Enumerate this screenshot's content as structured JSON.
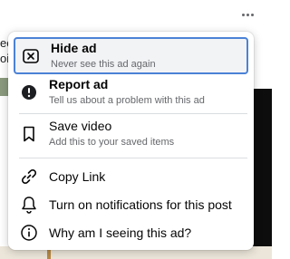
{
  "background": {
    "snippet_line1": "ec",
    "snippet_line2": "oil"
  },
  "menu": {
    "items": [
      {
        "title": "Hide ad",
        "subtitle": "Never see this ad again",
        "icon": "close-box-icon",
        "selected": true
      },
      {
        "title": "Report ad",
        "subtitle": "Tell us about a problem with this ad",
        "icon": "report-icon"
      },
      {
        "title": "Save video",
        "subtitle": "Add this to your saved items",
        "icon": "bookmark-icon"
      },
      {
        "title": "Copy Link",
        "icon": "link-icon"
      },
      {
        "title": "Turn on notifications for this post",
        "icon": "bell-icon"
      },
      {
        "title": "Why am I seeing this ad?",
        "icon": "info-icon"
      }
    ]
  },
  "colors": {
    "focus_ring": "#4b82d6",
    "text_primary": "#050505",
    "text_secondary": "#65676b"
  }
}
